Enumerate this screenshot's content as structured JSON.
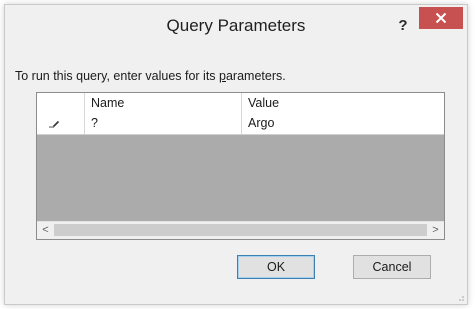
{
  "window": {
    "title": "Query Parameters",
    "help_label": "?",
    "close_icon": "close-icon"
  },
  "instructions": {
    "prefix": "To run this query, enter values for its ",
    "accel": "p",
    "suffix": "arameters."
  },
  "grid": {
    "columns": [
      "",
      "Name",
      "Value"
    ],
    "rows": [
      {
        "row_icon": "edit-pencil-icon",
        "name": "?",
        "value": "Argo"
      }
    ],
    "scroll_left_label": "<",
    "scroll_right_label": ">"
  },
  "buttons": {
    "ok_label": "OK",
    "cancel_label": "Cancel"
  },
  "colors": {
    "close_button": "#c75050",
    "grid_empty_area": "#ababab",
    "dialog_background": "#f0f0f0"
  }
}
